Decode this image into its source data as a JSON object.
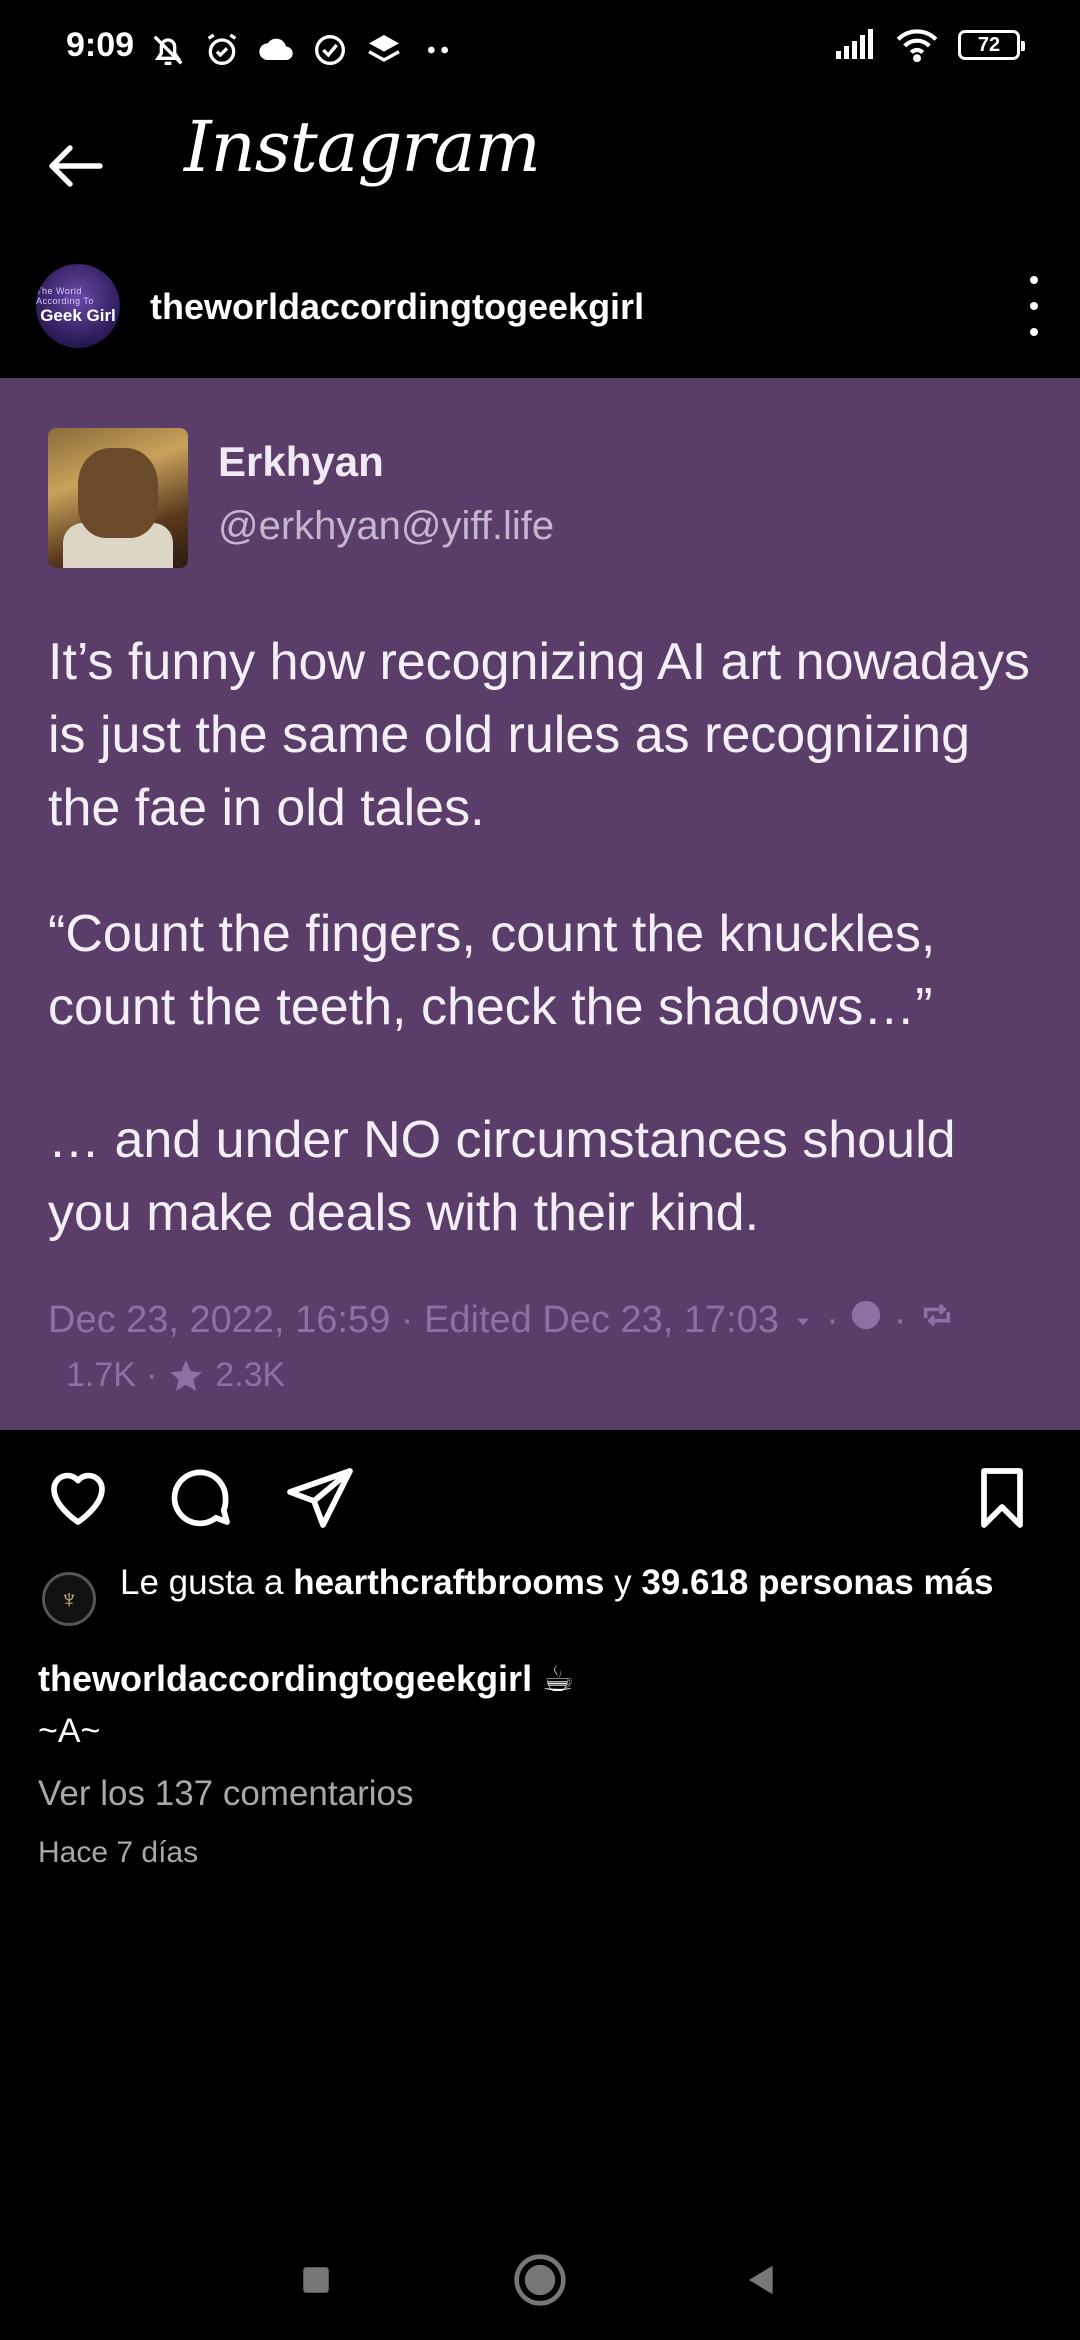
{
  "status_bar": {
    "time": "9:09",
    "battery": "72",
    "left_icons": [
      "bell-off-icon",
      "alarm-icon",
      "cloud-icon",
      "check-circle-icon",
      "layers-icon",
      "more-dots-icon"
    ],
    "right_icons": [
      "signal-icon",
      "wifi-icon",
      "battery-icon"
    ]
  },
  "app_bar": {
    "title": "Instagram",
    "back_icon": "arrow-left-icon"
  },
  "post": {
    "username": "theworldaccordingtogeekgirl",
    "avatar_text_small": "The World According To",
    "avatar_text_big": "Geek Girl",
    "more_icon": "vertical-dots-icon"
  },
  "tweet": {
    "author_name": "Erkhyan",
    "author_handle": "@erkhyan@yiff.life",
    "paragraph_1": "It’s funny how recognizing AI art nowadays is just the same old rules as recognizing the fae in old tales.",
    "paragraph_2": "“Count the fingers, count the knuckles, count the teeth, check the shadows…”",
    "paragraph_3": "… and under NO circumstances should you make deals with their kind.",
    "date": "Dec 23, 2022, 16:59 · Edited Dec 23, 17:03",
    "boosts": "1.7K",
    "favourites": "2.3K",
    "colors": {
      "background": "#5a3d69",
      "text": "#f4eef6",
      "meta": "#8f70a5"
    }
  },
  "actions": {
    "like_icon": "heart-icon",
    "comment_icon": "comment-icon",
    "share_icon": "send-icon",
    "save_icon": "bookmark-icon"
  },
  "likes": {
    "prefix": "Le gusta a ",
    "user": "hearthcraftbrooms",
    "connector": " y ",
    "others": "39.618 personas más"
  },
  "caption": {
    "username": "theworldaccordingtogeekgirl",
    "emoji": "☕",
    "line2": "~A~"
  },
  "comments_link": "Ver los 137 comentarios",
  "time_ago": "Hace 7 días",
  "nav": {
    "icons": [
      "recents-square-icon",
      "home-circle-icon",
      "back-triangle-icon"
    ]
  }
}
